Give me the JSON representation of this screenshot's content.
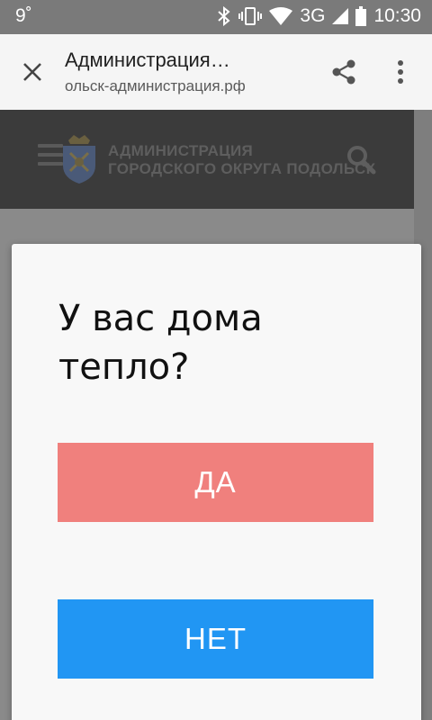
{
  "status_bar": {
    "temperature": "9˚",
    "network": "3G",
    "time": "10:30",
    "icons": [
      "bluetooth-icon",
      "vibrate-icon",
      "wifi-icon",
      "signal-icon",
      "battery-icon"
    ]
  },
  "toolbar": {
    "title": "Администрация…",
    "url": "ольск-администрация.рф",
    "icons": [
      "close-icon",
      "share-icon",
      "more-vert-icon"
    ]
  },
  "site_header": {
    "name_line1": "АДМИНИСТРАЦИЯ",
    "name_line2": "ГОРОДСКОГО ОКРУГА ПОДОЛЬСК",
    "icons": [
      "hamburger-icon",
      "emblem-icon",
      "search-icon"
    ]
  },
  "dialog": {
    "question": "У вас дома тепло?",
    "yes_label": "ДА",
    "no_label": "НЕТ"
  },
  "colors": {
    "yes_button": "#f0807d",
    "no_button": "#2196f3",
    "toolbar_bg": "#f5f5f5",
    "header_bg": "#3b3b3b"
  }
}
